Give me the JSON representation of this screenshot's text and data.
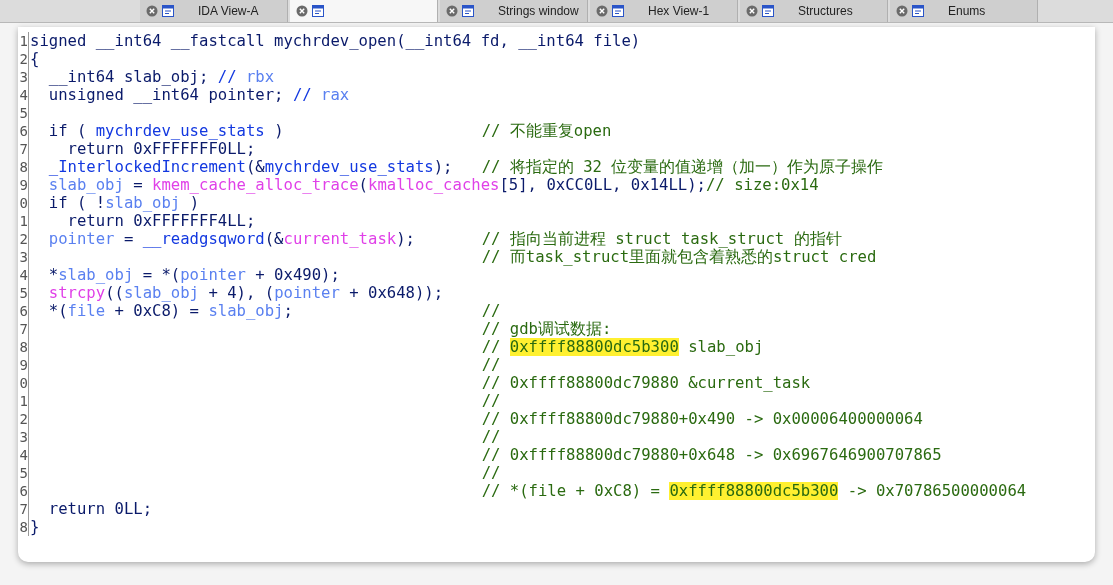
{
  "tabs": [
    {
      "label": "IDA View-A",
      "selected": false
    },
    {
      "selected": true
    },
    {
      "label": "Strings window",
      "selected": false
    },
    {
      "label": "Hex View-1",
      "selected": false
    },
    {
      "label": "Structures",
      "selected": false
    },
    {
      "label": "Enums",
      "selected": false
    }
  ],
  "code_lines": [
    {
      "number": "1",
      "code": [
        {
          "kind": "code",
          "text": "signed __int64 __fastcall mychrdev_open(__int64 fd, __int64 file)"
        }
      ]
    },
    {
      "number": "2",
      "code": [
        {
          "kind": "code",
          "text": "{"
        }
      ]
    },
    {
      "number": "3",
      "code": [
        {
          "kind": "code",
          "text": "  __int64 slab_obj; "
        },
        {
          "kind": "global",
          "text": "//"
        },
        {
          "kind": "local",
          "text": " rbx"
        }
      ]
    },
    {
      "number": "4",
      "code": [
        {
          "kind": "code",
          "text": "  unsigned __int64 pointer; "
        },
        {
          "kind": "global",
          "text": "//"
        },
        {
          "kind": "local",
          "text": " rax"
        }
      ]
    },
    {
      "number": "5"
    },
    {
      "number": "6",
      "code": [
        {
          "kind": "code",
          "text": "  if ( "
        },
        {
          "kind": "global",
          "text": "mychrdev_use_stats"
        },
        {
          "kind": "code",
          "text": " )"
        }
      ],
      "comment": [
        {
          "kind": "comment",
          "text": "// 不能重复open"
        }
      ]
    },
    {
      "number": "7",
      "code": [
        {
          "kind": "code",
          "text": "    return 0xFFFFFFF0LL;"
        }
      ]
    },
    {
      "number": "8",
      "code": [
        {
          "kind": "global",
          "text": "  _InterlockedIncrement"
        },
        {
          "kind": "code",
          "text": "(&"
        },
        {
          "kind": "global",
          "text": "mychrdev_use_stats"
        },
        {
          "kind": "code",
          "text": ");"
        }
      ],
      "comment": [
        {
          "kind": "comment",
          "text": "// 将指定的 32 位变量的值递增（加一）作为原子操作"
        }
      ]
    },
    {
      "number": "9",
      "code": [
        {
          "kind": "local",
          "text": "  slab_obj"
        },
        {
          "kind": "code",
          "text": " = "
        },
        {
          "kind": "import",
          "text": "kmem_cache_alloc_trace"
        },
        {
          "kind": "code",
          "text": "("
        },
        {
          "kind": "import",
          "text": "kmalloc_caches"
        },
        {
          "kind": "code",
          "text": "[5], 0xCC0LL, 0x14LL);"
        },
        {
          "kind": "comment",
          "text": "// size:0x14"
        }
      ]
    },
    {
      "number": "0",
      "code": [
        {
          "kind": "code",
          "text": "  if ( !"
        },
        {
          "kind": "local",
          "text": "slab_obj"
        },
        {
          "kind": "code",
          "text": " )"
        }
      ]
    },
    {
      "number": "1",
      "code": [
        {
          "kind": "code",
          "text": "    return 0xFFFFFFF4LL;"
        }
      ]
    },
    {
      "number": "2",
      "code": [
        {
          "kind": "local",
          "text": "  pointer"
        },
        {
          "kind": "code",
          "text": " = "
        },
        {
          "kind": "global",
          "text": "__readgsqword"
        },
        {
          "kind": "code",
          "text": "(&"
        },
        {
          "kind": "import",
          "text": "current_task"
        },
        {
          "kind": "code",
          "text": ");"
        }
      ],
      "comment": [
        {
          "kind": "comment",
          "text": "// 指向当前进程 struct task_struct 的指针"
        }
      ]
    },
    {
      "number": "3",
      "comment": [
        {
          "kind": "comment",
          "text": "// 而task_struct里面就包含着熟悉的struct cred"
        }
      ]
    },
    {
      "number": "4",
      "code": [
        {
          "kind": "code",
          "text": "  *"
        },
        {
          "kind": "local",
          "text": "slab_obj"
        },
        {
          "kind": "code",
          "text": " = *("
        },
        {
          "kind": "local",
          "text": "pointer"
        },
        {
          "kind": "code",
          "text": " + 0x490);"
        }
      ]
    },
    {
      "number": "5",
      "code": [
        {
          "kind": "import",
          "text": "  strcpy"
        },
        {
          "kind": "code",
          "text": "(("
        },
        {
          "kind": "local",
          "text": "slab_obj"
        },
        {
          "kind": "code",
          "text": " + 4), ("
        },
        {
          "kind": "local",
          "text": "pointer"
        },
        {
          "kind": "code",
          "text": " + 0x648));"
        }
      ]
    },
    {
      "number": "6",
      "code": [
        {
          "kind": "code",
          "text": "  *("
        },
        {
          "kind": "local",
          "text": "file"
        },
        {
          "kind": "code",
          "text": " + 0xC8) = "
        },
        {
          "kind": "local",
          "text": "slab_obj"
        },
        {
          "kind": "code",
          "text": ";"
        }
      ],
      "comment": [
        {
          "kind": "comment",
          "text": "//"
        }
      ]
    },
    {
      "number": "7",
      "comment": [
        {
          "kind": "comment",
          "text": "// gdb调试数据:"
        }
      ]
    },
    {
      "number": "8",
      "comment": [
        {
          "kind": "comment",
          "text": "// "
        },
        {
          "kind": "marked",
          "text": "0xffff88800dc5b300"
        },
        {
          "kind": "comment",
          "text": " slab_obj"
        }
      ]
    },
    {
      "number": "9",
      "comment": [
        {
          "kind": "comment",
          "text": "//"
        }
      ]
    },
    {
      "number": "0",
      "comment": [
        {
          "kind": "comment",
          "text": "// 0xffff88800dc79880 &current_task"
        }
      ]
    },
    {
      "number": "1",
      "comment": [
        {
          "kind": "comment",
          "text": "//"
        }
      ]
    },
    {
      "number": "2",
      "comment": [
        {
          "kind": "comment",
          "text": "// 0xffff88800dc79880+0x490 -> 0x00006400000064"
        }
      ]
    },
    {
      "number": "3",
      "comment": [
        {
          "kind": "comment",
          "text": "//"
        }
      ]
    },
    {
      "number": "4",
      "comment": [
        {
          "kind": "comment",
          "text": "// 0xffff88800dc79880+0x648 -> 0x6967646900707865"
        }
      ]
    },
    {
      "number": "5",
      "comment": [
        {
          "kind": "comment",
          "text": "//"
        }
      ]
    },
    {
      "number": "6",
      "comment": [
        {
          "kind": "comment",
          "text": "// *(file + 0xC8) = "
        },
        {
          "kind": "marked",
          "text": "0xffff88800dc5b300"
        },
        {
          "kind": "comment",
          "text": " -> 0x70786500000064"
        }
      ]
    },
    {
      "number": "7",
      "code": [
        {
          "kind": "code",
          "text": "  return 0LL;"
        }
      ]
    },
    {
      "number": "8",
      "code": [
        {
          "kind": "code",
          "text": "}"
        }
      ]
    }
  ]
}
